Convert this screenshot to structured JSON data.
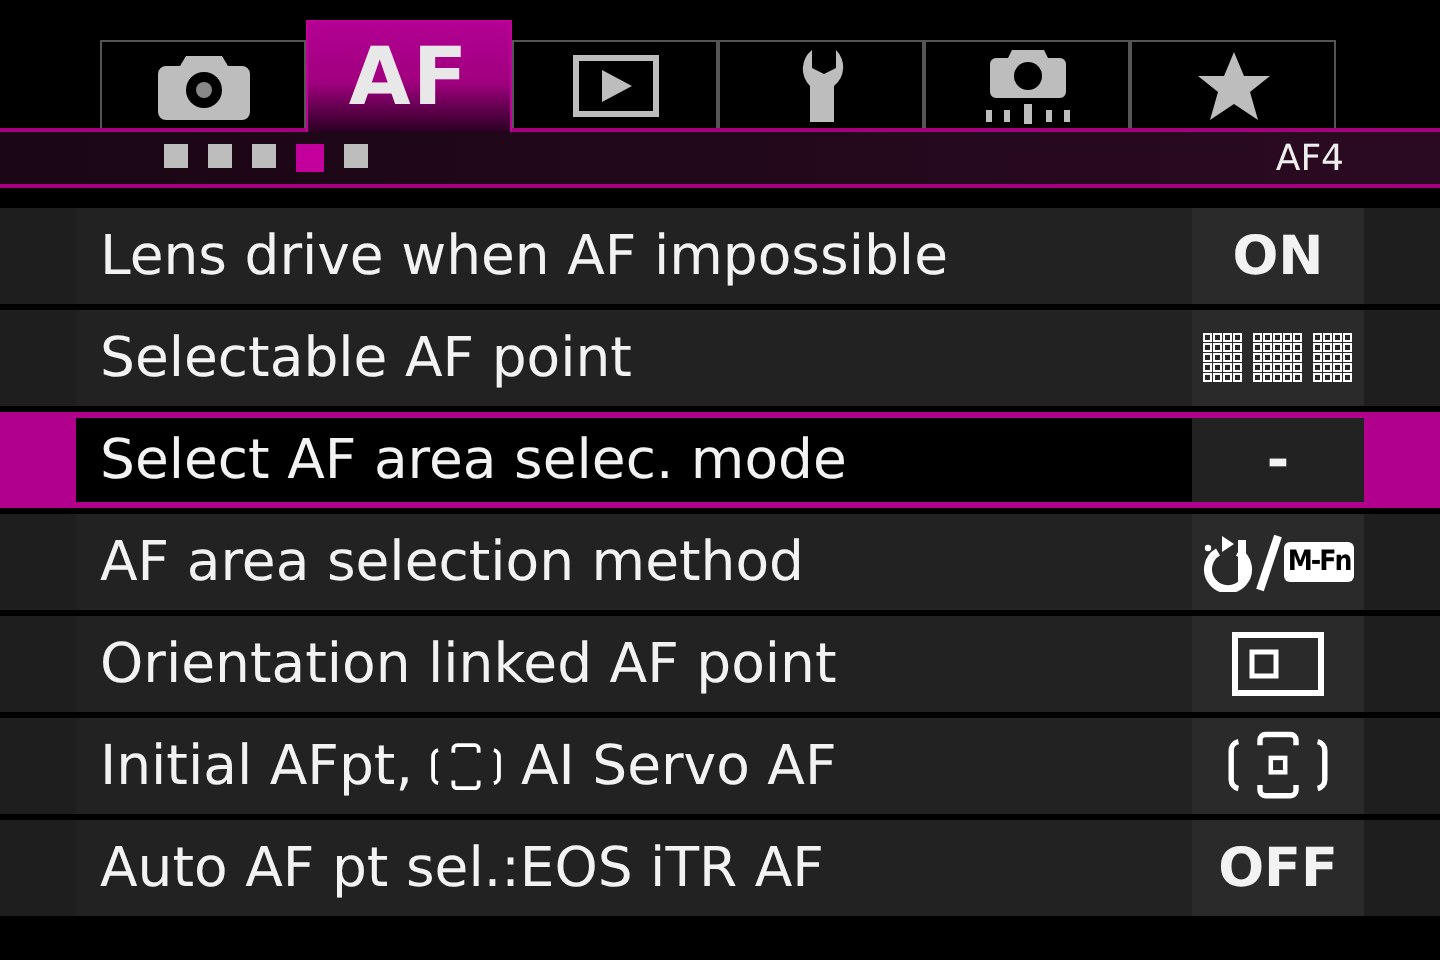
{
  "tabs": [
    {
      "kind": "camera",
      "selected": false
    },
    {
      "kind": "af",
      "text": "AF",
      "selected": true
    },
    {
      "kind": "play",
      "selected": false
    },
    {
      "kind": "wrench",
      "selected": false
    },
    {
      "kind": "custom",
      "selected": false
    },
    {
      "kind": "star",
      "selected": false
    }
  ],
  "pages": [
    {
      "selected": false
    },
    {
      "selected": false
    },
    {
      "selected": false
    },
    {
      "selected": true
    },
    {
      "selected": false
    }
  ],
  "page_label": "AF4",
  "rows": [
    {
      "label": "Lens drive when AF impossible",
      "selected": false,
      "value": {
        "kind": "text",
        "text": "ON"
      }
    },
    {
      "label": "Selectable AF point",
      "selected": false,
      "value": {
        "kind": "af-points"
      }
    },
    {
      "label": "Select AF area selec. mode",
      "selected": true,
      "value": {
        "kind": "text",
        "text": "-"
      }
    },
    {
      "label": "AF area selection method",
      "selected": false,
      "value": {
        "kind": "dial-mfn",
        "text": "M-Fn"
      }
    },
    {
      "label": "Orientation linked AF point",
      "selected": false,
      "value": {
        "kind": "frame-point"
      }
    },
    {
      "label": "Initial AFpt,",
      "label_end": "AI Servo AF",
      "selected": false,
      "value": {
        "kind": "zone-point"
      }
    },
    {
      "label": "Auto AF pt sel.:EOS iTR AF",
      "selected": false,
      "value": {
        "kind": "text",
        "text": "OFF"
      }
    }
  ]
}
